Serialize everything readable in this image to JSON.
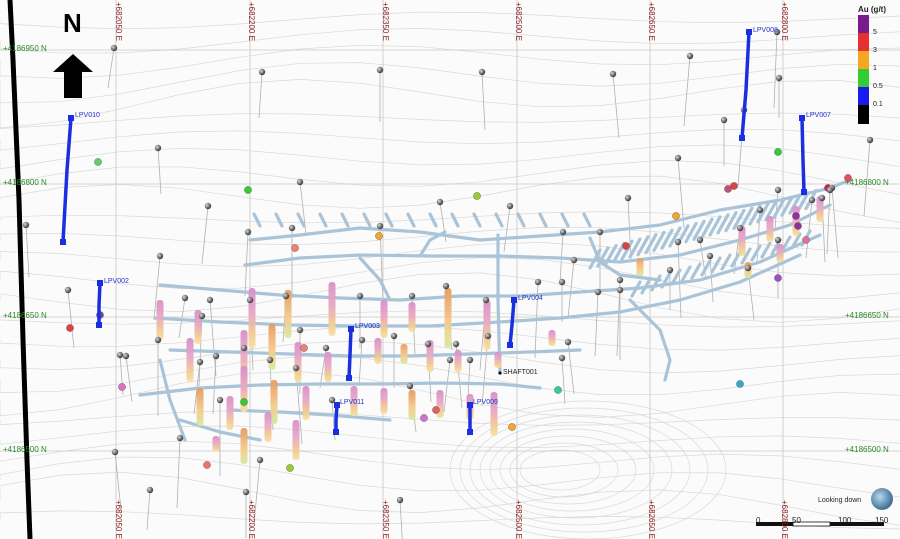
{
  "map": {
    "north_label": "N",
    "easting_labels": [
      "+682050 E",
      "+682200 E",
      "+682350 E",
      "+682500 E",
      "+682650 E",
      "+682800 E"
    ],
    "northing_labels": [
      "+4186950 N",
      "+4186800 N",
      "+4186650 N",
      "+4186500 N"
    ],
    "drill_holes": [
      "LPV010",
      "LPV008",
      "LPV007",
      "LPV002",
      "LPV004",
      "LPV003",
      "LPV011",
      "LPV009"
    ],
    "shaft_label": "SHAFT001",
    "view_label": "Looking down",
    "scale_ticks": [
      "0",
      "50",
      "100",
      "150"
    ]
  },
  "legend": {
    "title": "Au (g/t)",
    "colors": [
      "#7a1a8c",
      "#e83030",
      "#f5a623",
      "#33cc33",
      "#1a1aee",
      "#000000"
    ],
    "ticks": [
      "5",
      "3",
      "1",
      "0.5",
      "0.1"
    ]
  }
}
